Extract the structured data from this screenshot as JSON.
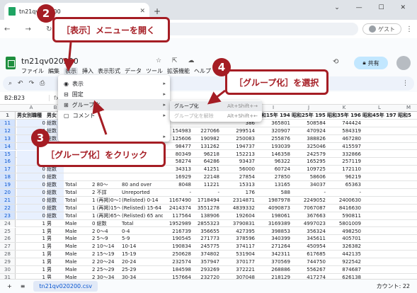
{
  "browser": {
    "tab_title": "tn21qv020200",
    "guest_label": "ゲスト"
  },
  "sheets": {
    "file_name": "tn21qv020200",
    "menus": [
      "ファイル",
      "編集",
      "表示",
      "挿入",
      "表示形式",
      "データ",
      "ツール",
      "拡張機能",
      "ヘルプ"
    ],
    "share_label": "共有",
    "font_size": "10",
    "name_box": "B2:B23"
  },
  "view_menu": {
    "items": [
      {
        "icon": "eye",
        "label": "表示",
        "has_sub": true
      },
      {
        "icon": "pin",
        "label": "固定",
        "has_sub": true
      },
      {
        "icon": "group",
        "label": "グループ化",
        "has_sub": true
      },
      {
        "icon": "comment",
        "label": "コメント",
        "has_sub": true
      },
      {
        "icon": "",
        "label": "",
        "has_sub": false
      },
      {
        "icon": "",
        "label": "",
        "has_sub": true
      }
    ]
  },
  "group_submenu": {
    "items": [
      {
        "label": "グループ化",
        "shortcut": "Alt+Shift+→",
        "disabled": false
      },
      {
        "label": "グループ化を解除",
        "shortcut": "Alt+Shift+←",
        "disabled": true
      }
    ]
  },
  "callouts": {
    "c2": {
      "num": "2",
      "text": "［表示］メニューを開く"
    },
    "c3": {
      "num": "3",
      "text": "［グループ化］をクリック"
    },
    "c4": {
      "num": "4",
      "text": "［グループ化］を選択"
    }
  },
  "columns": [
    "A",
    "B",
    "C",
    "D",
    "E",
    "F",
    "G",
    "H",
    "I",
    "J",
    "K",
    "L",
    "M"
  ],
  "col_headers_visible": [
    "男女別職種",
    "男女",
    "",
    "",
    "",
    "",
    "",
    "",
    "昭和15年 1940",
    "昭和25年 1950",
    "昭和35年 1960",
    "昭和45年 1970",
    "昭和5"
  ],
  "rows": [
    {
      "n": "11",
      "c": [
        "0",
        "総数",
        "",
        "",
        "",
        "",
        "",
        "386",
        "365801",
        "508584",
        "744424"
      ]
    },
    {
      "n": "12",
      "c": [
        "0",
        "総数",
        "",
        "",
        "154983",
        "227066",
        "299514",
        "320907",
        "470924",
        "584319"
      ]
    },
    {
      "n": "13",
      "c": [
        "0",
        "総数",
        "",
        "",
        "125606",
        "190982",
        "250083",
        "255876",
        "388826",
        "467280"
      ]
    },
    {
      "n": "14",
      "c": [
        "0",
        "総数",
        "",
        "",
        "98477",
        "131262",
        "194737",
        "193039",
        "325046",
        "415597"
      ]
    },
    {
      "n": "15",
      "c": [
        "0",
        "総数",
        "",
        "",
        "80349",
        "96218",
        "152213",
        "146358",
        "242579",
        "332866"
      ]
    },
    {
      "n": "16",
      "c": [
        "0",
        "総数",
        "",
        "",
        "58274",
        "64286",
        "93437",
        "96322",
        "165295",
        "257119"
      ]
    },
    {
      "n": "17",
      "c": [
        "0",
        "総数",
        "",
        "",
        "34313",
        "41251",
        "56000",
        "60724",
        "109725",
        "172110"
      ]
    },
    {
      "n": "18",
      "c": [
        "0",
        "総数",
        "",
        "",
        "16929",
        "22148",
        "27854",
        "27850",
        "58606",
        "96219"
      ]
    },
    {
      "n": "19",
      "c": [
        "0",
        "総数",
        "Total",
        "2 80～",
        "80 and over",
        "8048",
        "11221",
        "15313",
        "13165",
        "34037",
        "65363"
      ]
    },
    {
      "n": "20",
      "c": [
        "0",
        "総数",
        "Total",
        "2 不詳",
        "Unreported",
        "-",
        "-",
        "176",
        "588",
        "-",
        "-"
      ]
    },
    {
      "n": "21",
      "c": [
        "0",
        "総数",
        "Total",
        "1 (再掲)0～14",
        "(Relisted) 0-14",
        "1167490",
        "1718494",
        "2314871",
        "1987978",
        "2249052",
        "2400630"
      ]
    },
    {
      "n": "22",
      "c": [
        "0",
        "総数",
        "Total",
        "1 (再掲)15～64",
        "(Relisted) 15-64",
        "2414374",
        "3551278",
        "4839332",
        "4090873",
        "7067087",
        "8416630"
      ]
    },
    {
      "n": "23",
      "c": [
        "0",
        "総数",
        "Total",
        "1 (再掲)65～",
        "(Relisted) 65 and over",
        "117564",
        "138906",
        "192604",
        "198061",
        "367663",
        "590811"
      ]
    },
    {
      "n": "24",
      "c": [
        "1",
        "男",
        "Male",
        "0 総数",
        "Total",
        "1952989",
        "2855323",
        "3790831",
        "3169389",
        "4997023",
        "5801009"
      ]
    },
    {
      "n": "25",
      "c": [
        "1",
        "男",
        "Male",
        "2 0～4",
        "0-4",
        "216739",
        "356655",
        "427395",
        "398853",
        "356324",
        "498250"
      ]
    },
    {
      "n": "26",
      "c": [
        "1",
        "男",
        "Male",
        "2 5～9",
        "5-9",
        "190545",
        "271773",
        "378596",
        "340399",
        "345611",
        "405701"
      ]
    },
    {
      "n": "27",
      "c": [
        "1",
        "男",
        "Male",
        "2 10～14",
        "10-14",
        "190834",
        "245775",
        "374117",
        "271264",
        "450954",
        "326382"
      ]
    },
    {
      "n": "28",
      "c": [
        "1",
        "男",
        "Male",
        "2 15～19",
        "15-19",
        "250628",
        "374802",
        "531904",
        "342311",
        "617685",
        "442135"
      ]
    },
    {
      "n": "29",
      "c": [
        "1",
        "男",
        "Male",
        "2 20～24",
        "20-24",
        "232574",
        "357947",
        "370177",
        "370569",
        "744750",
        "922542"
      ]
    },
    {
      "n": "30",
      "c": [
        "1",
        "男",
        "Male",
        "2 25～29",
        "25-29",
        "184598",
        "293269",
        "372221",
        "268886",
        "556267",
        "874687"
      ]
    },
    {
      "n": "31",
      "c": [
        "1",
        "男",
        "Male",
        "2 30～34",
        "30-34",
        "157664",
        "232720",
        "307048",
        "218129",
        "417274",
        "626138"
      ]
    },
    {
      "n": "32",
      "c": [
        "1",
        "男",
        "Male",
        "2 35～39",
        "35-39",
        "124712",
        "185006",
        "264826",
        "176897",
        "343364",
        "580471"
      ]
    }
  ],
  "bottom": {
    "add": "+",
    "list": "≡",
    "sheet_name": "tn21qv020200.csv",
    "count": "カウント: 22"
  }
}
